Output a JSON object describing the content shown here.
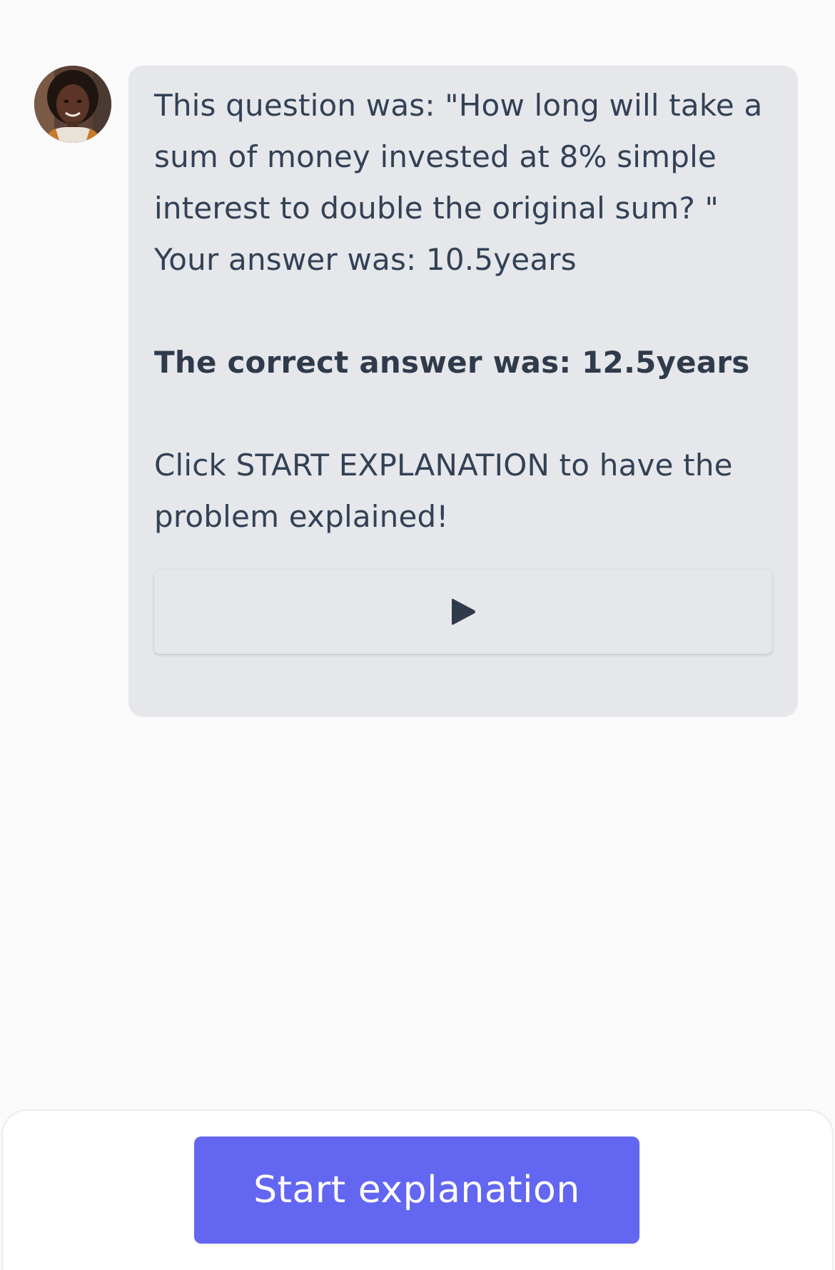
{
  "chat": {
    "message": {
      "line_question": "This question was: \"How long will take a sum of money invested at 8% simple interest to double the original sum? \"",
      "line_your_answer": "Your answer was: 10.5years",
      "line_correct_answer": "The correct answer was: 12.5years",
      "line_instruction": "Click START EXPLANATION to have the problem explained!"
    },
    "audio_button": {
      "icon": "play-icon"
    },
    "avatar": {
      "icon": "tutor-avatar"
    }
  },
  "footer": {
    "start_button_label": "Start explanation"
  },
  "colors": {
    "background": "#fafafa",
    "bubble": "#e5e7eb",
    "text": "#334155",
    "accent": "#6366f1"
  }
}
